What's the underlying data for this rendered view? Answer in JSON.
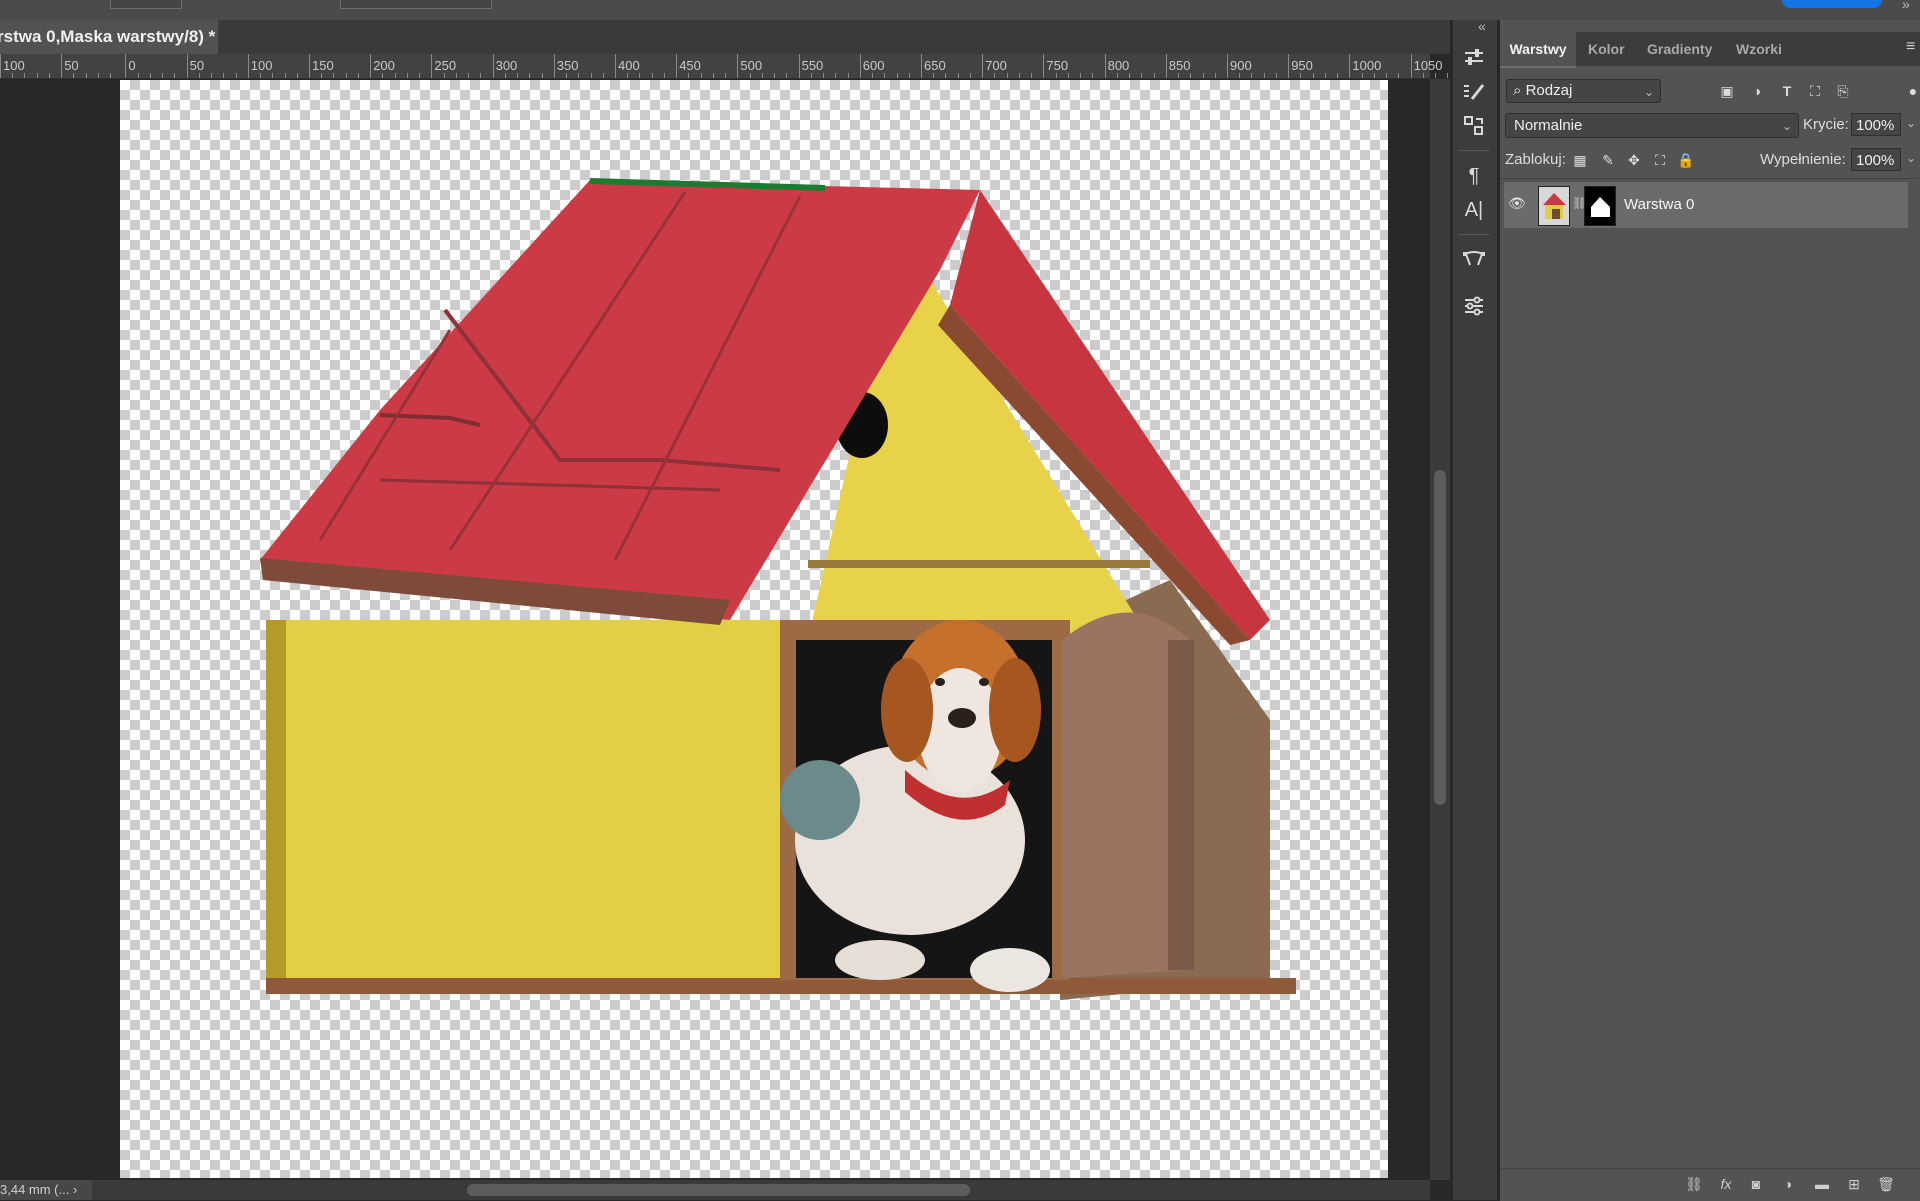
{
  "document_tab": {
    "title": "rstwa 0,Maska warstwy/8) *"
  },
  "ruler": {
    "labels": [
      "100",
      "50",
      "0",
      "50",
      "100",
      "150",
      "200",
      "250",
      "300",
      "350",
      "400",
      "450",
      "500",
      "550",
      "600",
      "650",
      "700",
      "750",
      "800",
      "850",
      "900",
      "950",
      "1000",
      "1050"
    ]
  },
  "status": {
    "text": "3,44 mm (... ›"
  },
  "tools": [
    {
      "icon": "adjustments-icon"
    },
    {
      "icon": "brush-settings-icon"
    },
    {
      "icon": "clone-source-icon"
    },
    {
      "icon": "paragraph-icon"
    },
    {
      "icon": "character-icon"
    },
    {
      "icon": "paths-icon"
    },
    {
      "icon": "properties-icon"
    }
  ],
  "panel": {
    "tabs": [
      "Warstwy",
      "Kolor",
      "Gradienty",
      "Wzorki"
    ],
    "active_tab": "Warstwy",
    "filter": {
      "label": "Rodzaj"
    },
    "blend_mode": "Normalnie",
    "opacity": {
      "label": "Krycie:",
      "value": "100%"
    },
    "lock": {
      "label": "Zablokuj:"
    },
    "fill": {
      "label": "Wypełnienie:",
      "value": "100%"
    },
    "layers": [
      {
        "name": "Warstwa 0",
        "visible": true,
        "has_mask": true
      }
    ]
  },
  "colors": {
    "accent": "#1473e6",
    "roof": "#cc3b45",
    "walls": "#e6d245"
  }
}
